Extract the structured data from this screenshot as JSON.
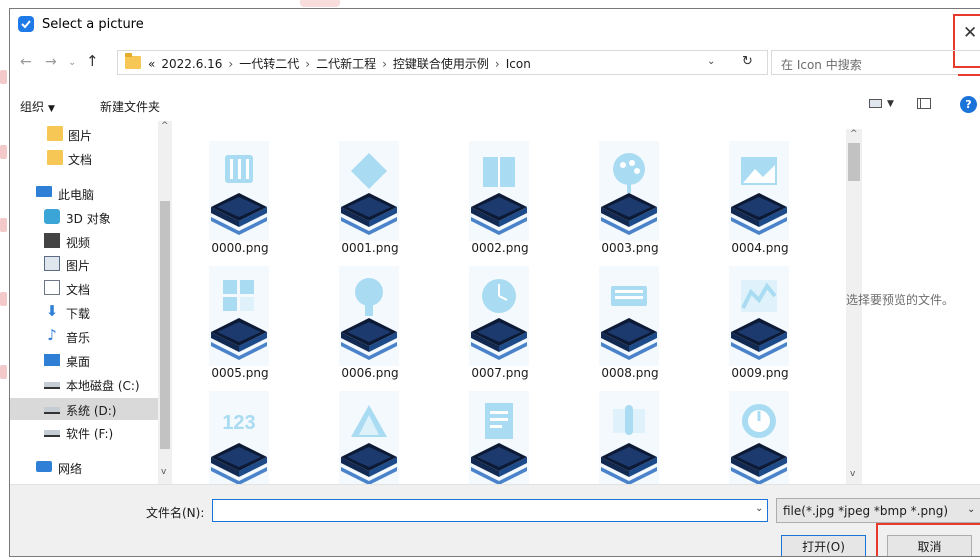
{
  "window": {
    "title": "Select a picture",
    "close_glyph": "✕"
  },
  "nav_buttons": {
    "back": "←",
    "forward": "→",
    "recent": "⌄",
    "up": "↑"
  },
  "address": {
    "prefix": "«",
    "crumbs": [
      "2022.6.16",
      "一代转二代",
      "二代新工程",
      "控键联合使用示例",
      "Icon"
    ],
    "separator": "›",
    "dropdown": "⌄",
    "refresh": "↻"
  },
  "search": {
    "placeholder": "在 Icon 中搜索"
  },
  "toolbar": {
    "organize": "组织",
    "organize_caret": "▼",
    "new_folder": "新建文件夹",
    "view_caret": "▼",
    "help": "?"
  },
  "nav_pane": {
    "items": [
      {
        "label": "图片",
        "icon": "folder-icon"
      },
      {
        "label": "文档",
        "icon": "folder-icon"
      },
      {
        "label": "此电脑",
        "icon": "computer-icon"
      },
      {
        "label": "3D 对象",
        "icon": "3d-objects-icon"
      },
      {
        "label": "视频",
        "icon": "video-icon"
      },
      {
        "label": "图片",
        "icon": "pictures-icon"
      },
      {
        "label": "文档",
        "icon": "documents-icon"
      },
      {
        "label": "下载",
        "icon": "download-icon"
      },
      {
        "label": "音乐",
        "icon": "music-icon"
      },
      {
        "label": "桌面",
        "icon": "desktop-icon"
      },
      {
        "label": "本地磁盘 (C:)",
        "icon": "drive-icon"
      },
      {
        "label": "系统 (D:)",
        "icon": "drive-icon",
        "selected": true
      },
      {
        "label": "软件 (F:)",
        "icon": "drive-icon"
      },
      {
        "label": "网络",
        "icon": "network-icon"
      }
    ],
    "scroll_up": "^",
    "scroll_down": "v"
  },
  "files": [
    {
      "name": "0000.png",
      "glyph": "sliders"
    },
    {
      "name": "0001.png",
      "glyph": "diamond"
    },
    {
      "name": "0002.png",
      "glyph": "book"
    },
    {
      "name": "0003.png",
      "glyph": "palette"
    },
    {
      "name": "0004.png",
      "glyph": "image"
    },
    {
      "name": "0005.png",
      "glyph": "grid"
    },
    {
      "name": "0006.png",
      "glyph": "bulb"
    },
    {
      "name": "0007.png",
      "glyph": "clock"
    },
    {
      "name": "0008.png",
      "glyph": "keyboard"
    },
    {
      "name": "0009.png",
      "glyph": "chart"
    },
    {
      "name": "",
      "glyph": "123",
      "text": "123"
    },
    {
      "name": "",
      "glyph": "triangle"
    },
    {
      "name": "",
      "glyph": "document"
    },
    {
      "name": "",
      "glyph": "touch"
    },
    {
      "name": "",
      "glyph": "gauge"
    }
  ],
  "file_scroll": {
    "up": "^",
    "down": "v"
  },
  "preview": {
    "text": "选择要预览的文件。"
  },
  "bottom": {
    "filename_label": "文件名(N):",
    "filename_value": "",
    "filename_dropdown": "⌄",
    "file_type": "file(*.jpg *jpeg *bmp *.png)",
    "file_type_caret": "⌄",
    "open_button": "打开(O)",
    "cancel_button": "取消"
  },
  "colors": {
    "accent": "#1a73d9",
    "highlight_frame": "#e53a2c",
    "icon_light": "#a9dcf2"
  }
}
